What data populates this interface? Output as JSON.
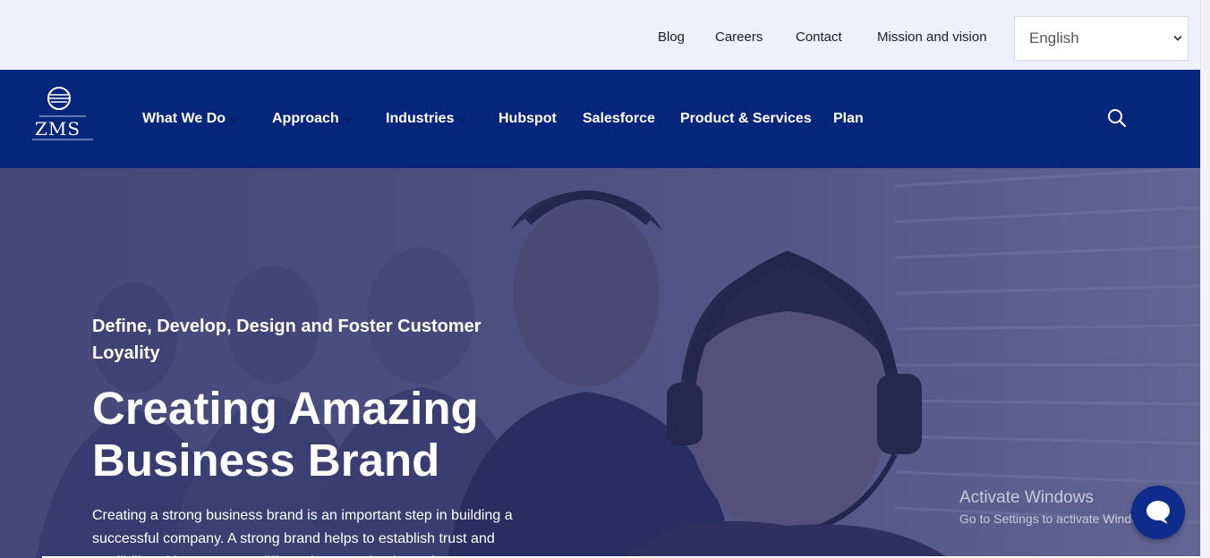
{
  "topbar": {
    "links": [
      {
        "label": "Blog"
      },
      {
        "label": "Careers"
      },
      {
        "label": "Contact"
      },
      {
        "label": "Mission and vision"
      }
    ],
    "language": {
      "selected": "English"
    }
  },
  "logo": {
    "text": "ZMS"
  },
  "nav": {
    "items": [
      {
        "label": "What We Do",
        "dropdown": true
      },
      {
        "label": "Approach",
        "dropdown": true
      },
      {
        "label": "Industries",
        "dropdown": true
      },
      {
        "label": "Hubspot",
        "dropdown": false
      },
      {
        "label": "Salesforce",
        "dropdown": false
      },
      {
        "label": "Product & Services",
        "dropdown": false
      },
      {
        "label": "Plan",
        "dropdown": false
      }
    ],
    "search_icon": "search-icon"
  },
  "hero": {
    "subtitle": "Define, Develop, Design and Foster Customer Loyality",
    "title": "Creating Amazing Business Brand",
    "body": "Creating a strong business brand is an important step in building a successful company. A strong brand helps to establish trust and credibility with customers, differentiate your business from"
  },
  "watermark": {
    "line1": "Activate Windows",
    "line2": "Go to Settings to activate Windows."
  },
  "chat": {
    "icon": "chat-bubble-icon"
  },
  "colors": {
    "nav_bg": "#05267b",
    "topbar_bg": "#eef0fb",
    "hero_overlay": "#282c68",
    "chat_button": "#0f2b8c"
  }
}
